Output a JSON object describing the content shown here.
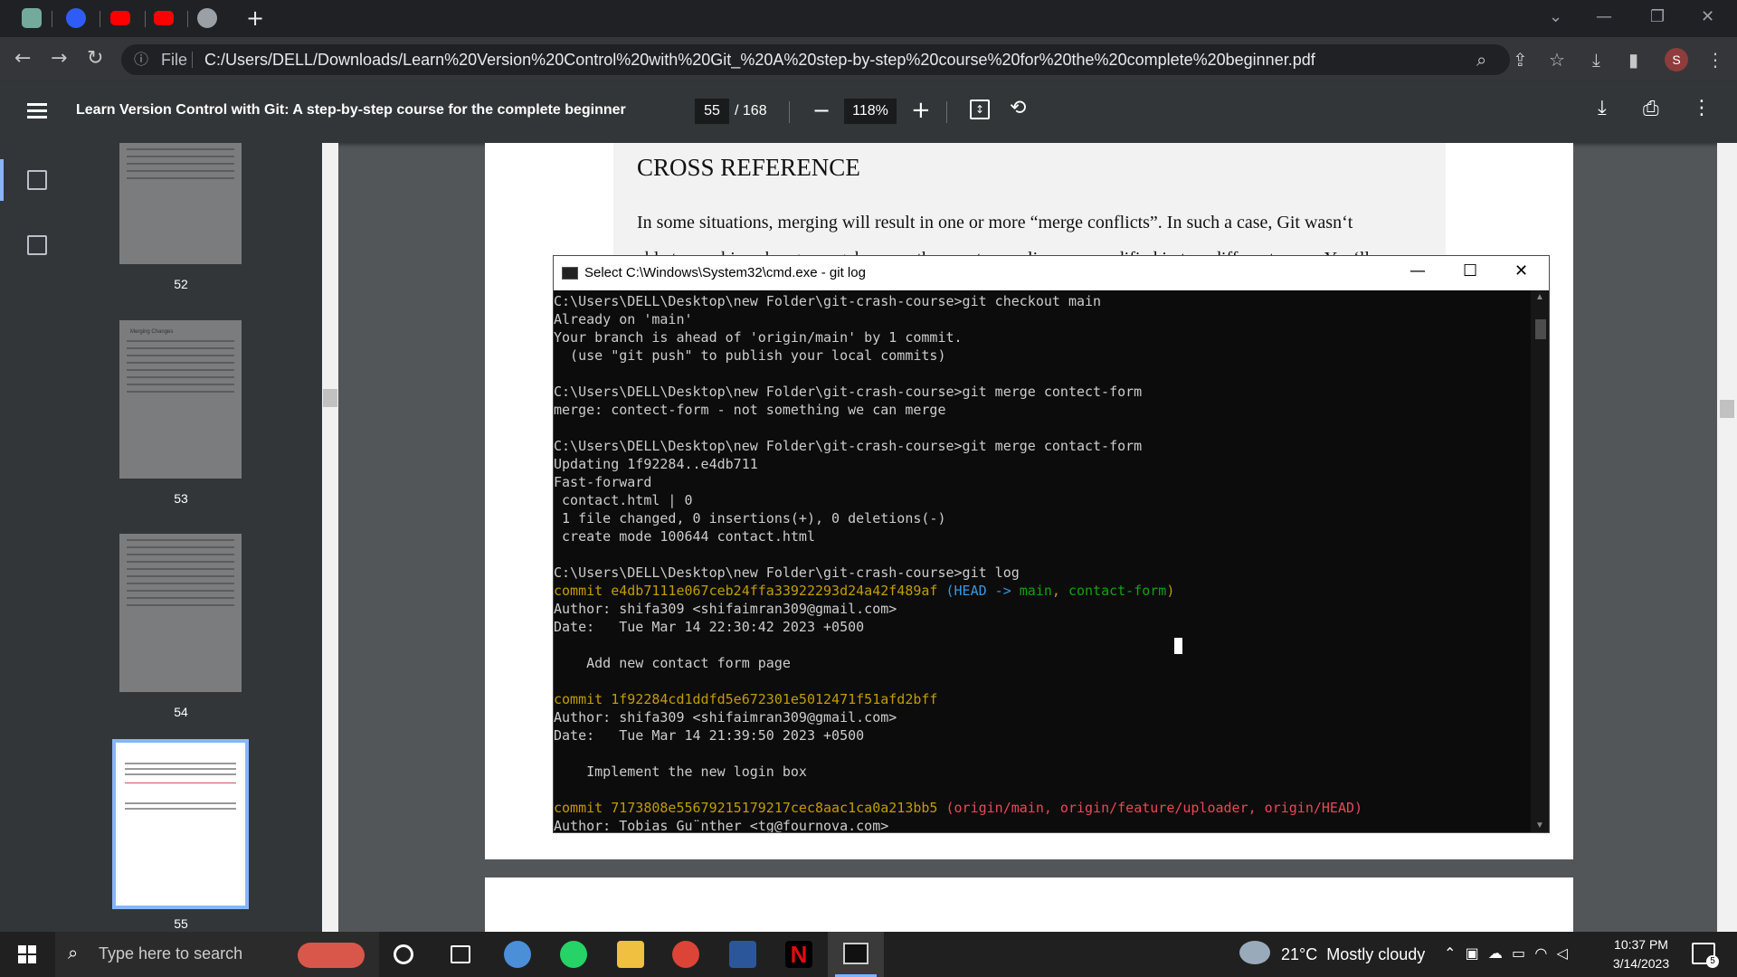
{
  "browser": {
    "tabs": [
      "chatgpt",
      "quora",
      "youtube",
      "youtube",
      "web"
    ],
    "new_tab": "+",
    "address": {
      "scheme": "File",
      "url": "C:/Users/DELL/Downloads/Learn%20Version%20Control%20with%20Git_%20A%20step-by-step%20course%20for%20the%20complete%20beginner.pdf"
    },
    "profile": "S"
  },
  "pdf": {
    "title": "Learn Version Control with Git: A step-by-step course for the complete beginner",
    "page": "55",
    "total": "/ 168",
    "zoom": "118%",
    "thumb_pages": [
      "52",
      "53",
      "54",
      "55"
    ],
    "thumb53_heading": "Merging Changes",
    "content": {
      "heading": "CROSS REFERENCE",
      "para1": "In some situations, merging will result in one or more “merge conflicts”. In such a case, Git wasn‘t",
      "para2": "able to combine changes, e.g. because the exact same line was modified in two different ways. You‘ll"
    }
  },
  "cmd": {
    "title": "Select C:\\Windows\\System32\\cmd.exe - git  log",
    "lines": [
      "C:\\Users\\DELL\\Desktop\\new Folder\\git-crash-course>git checkout main",
      "Already on 'main'",
      "Your branch is ahead of 'origin/main' by 1 commit.",
      "  (use \"git push\" to publish your local commits)",
      "",
      "C:\\Users\\DELL\\Desktop\\new Folder\\git-crash-course>git merge contect-form",
      "merge: contect-form - not something we can merge",
      "",
      "C:\\Users\\DELL\\Desktop\\new Folder\\git-crash-course>git merge contact-form",
      "Updating 1f92284..e4db711",
      "Fast-forward",
      " contact.html | 0",
      " 1 file changed, 0 insertions(+), 0 deletions(-)",
      " create mode 100644 contact.html",
      "",
      "C:\\Users\\DELL\\Desktop\\new Folder\\git-crash-course>git log"
    ],
    "commits": [
      {
        "hash": "commit e4db7111e067ceb24ffa33922293d24a42f489af",
        "refs": {
          "open": " (",
          "head": "HEAD -> ",
          "main": "main",
          "sep": ", ",
          "branch": "contact-form",
          "close": ")"
        },
        "author": "Author: shifa309 <shifaimran309@gmail.com>",
        "date": "Date:   Tue Mar 14 22:30:42 2023 +0500",
        "msg": "    Add new contact form page"
      },
      {
        "hash": "commit 1f92284cd1ddfd5e672301e5012471f51afd2bff",
        "author": "Author: shifa309 <shifaimran309@gmail.com>",
        "date": "Date:   Tue Mar 14 21:39:50 2023 +0500",
        "msg": "    Implement the new login box"
      },
      {
        "hash": "commit 7173808e55679215179217cec8aac1ca0a213bb5",
        "refs": "(origin/main, origin/feature/uploader, origin/HEAD)",
        "author": "Author: Tobias Gu¨nther <tg@fournova.com>"
      }
    ],
    "colors": {
      "hash": "#c19c00",
      "head": "#3a96dd",
      "branch": "#13a10e",
      "remote": "#e74856",
      "text": "#cccccc"
    }
  },
  "taskbar": {
    "search_placeholder": "Type here to search",
    "weather": "21°C  Mostly cloudy",
    "time": "10:37 PM",
    "date": "3/14/2023",
    "notifications": "5"
  }
}
